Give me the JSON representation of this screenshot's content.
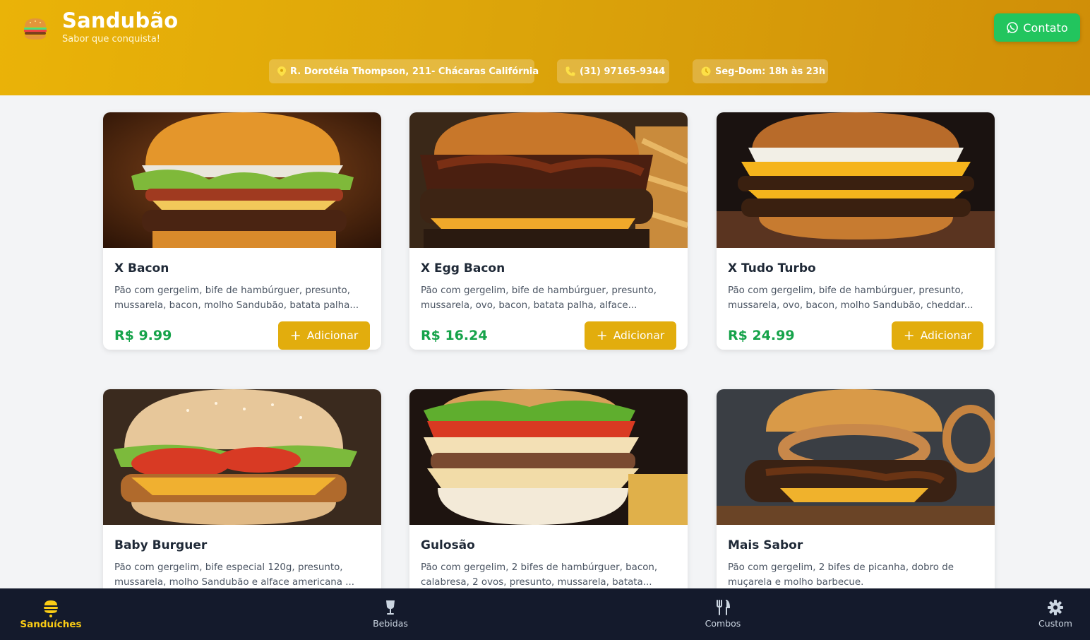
{
  "header": {
    "brand_title": "Sandubão",
    "brand_subtitle": "Sabor que conquista!",
    "contact_label": "Contato",
    "address": "R. Dorotéia Thompson, 211- Chácaras Califórnia",
    "phone": "(31) 97165-9344",
    "hours": "Seg-Dom: 18h às 23h"
  },
  "products": [
    {
      "name": "X Bacon",
      "desc": "Pão com gergelim, bife de hambúrguer, presunto, mussarela, bacon, molho Sandubão, batata palha...",
      "price": "R$ 9.99",
      "button": "Adicionar"
    },
    {
      "name": "X Egg Bacon",
      "desc": "Pão com gergelim, bife de hambúrguer, presunto, mussarela, ovo, bacon, batata palha, alface...",
      "price": "R$ 16.24",
      "button": "Adicionar"
    },
    {
      "name": "X Tudo Turbo",
      "desc": "Pão com gergelim, bife de hambúrguer, presunto, mussarela, ovo, bacon, molho Sandubão, cheddar...",
      "price": "R$ 24.99",
      "button": "Adicionar"
    },
    {
      "name": "Baby Burguer",
      "desc": "Pão com gergelim, bife especial 120g, presunto, mussarela, molho Sandubão e alface americana ...",
      "price": "",
      "button": ""
    },
    {
      "name": "Gulosão",
      "desc": "Pão com gergelim, 2 bifes de hambúrguer, bacon, calabresa, 2 ovos, presunto, mussarela, batata...",
      "price": "",
      "button": ""
    },
    {
      "name": "Mais Sabor",
      "desc": "Pão com gergelim, 2 bifes de picanha, dobro de muçarela e molho barbecue.",
      "price": "",
      "button": ""
    }
  ],
  "nav": {
    "items": [
      {
        "label": "Sanduíches",
        "icon": "burger-icon",
        "active": true
      },
      {
        "label": "Bebidas",
        "icon": "drink-icon",
        "active": false
      },
      {
        "label": "Combos",
        "icon": "utensils-icon",
        "active": false
      },
      {
        "label": "Custom",
        "icon": "gear-icon",
        "active": false
      }
    ]
  },
  "colors": {
    "brand": "#eab308",
    "accent_button": "#e2ad0d",
    "price": "#16a34a",
    "contact": "#22c55e",
    "nav_bg": "#141a2c",
    "nav_active": "#facc15"
  }
}
